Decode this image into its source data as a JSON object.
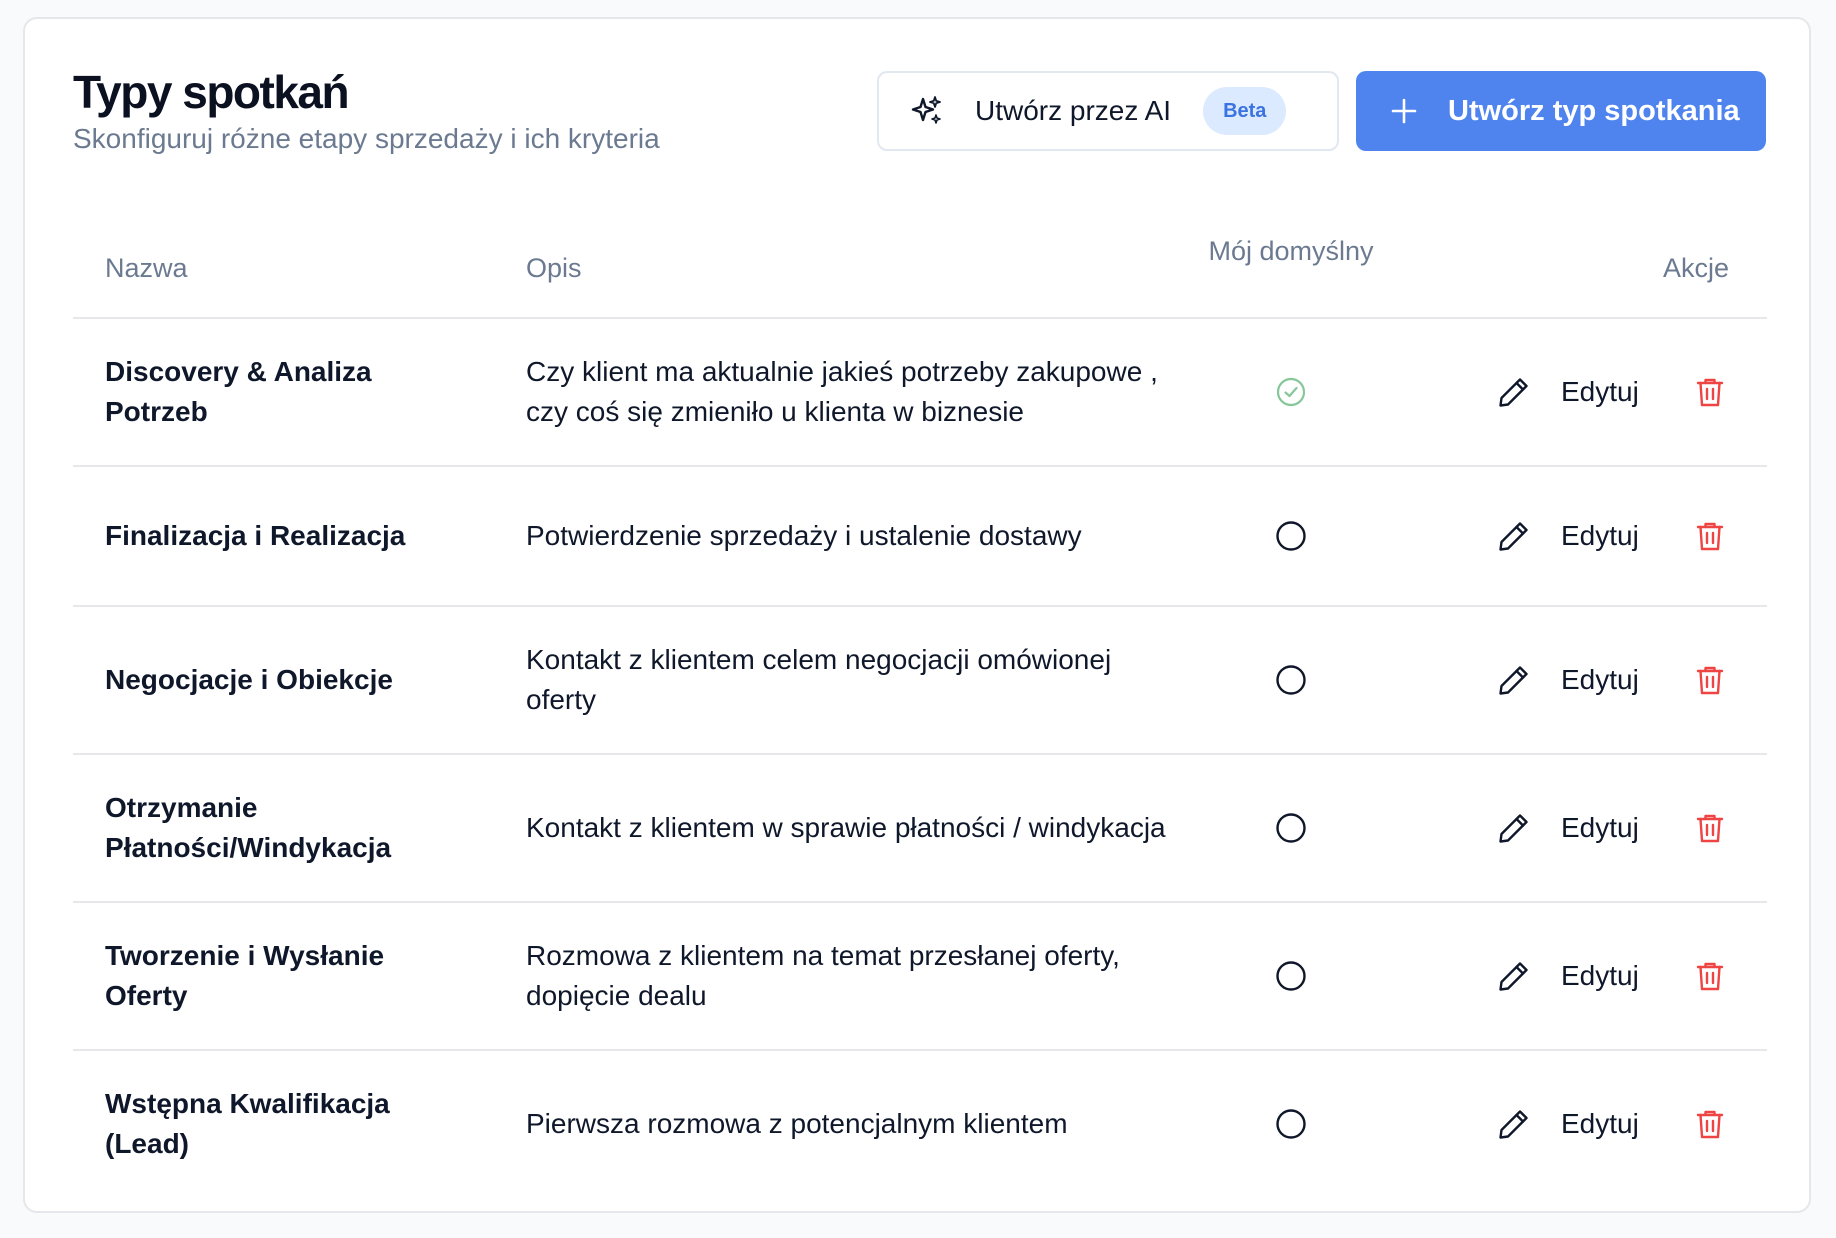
{
  "header": {
    "title": "Typy spotkań",
    "subtitle": "Skonfiguruj różne etapy sprzedaży i ich kryteria"
  },
  "actions": {
    "ai_button_label": "Utwórz przez AI",
    "ai_badge": "Beta",
    "create_button_label": "Utwórz typ spotkania"
  },
  "colors": {
    "primary": "#4f84ef",
    "danger": "#ef4444",
    "success": "#86c79a",
    "muted": "#6b7a90"
  },
  "table": {
    "columns": {
      "name": "Nazwa",
      "description": "Opis",
      "default": "Mój domyślny",
      "actions": "Akcje"
    },
    "edit_label": "Edytuj",
    "rows": [
      {
        "name": "Discovery & Analiza Potrzeb",
        "description": "Czy klient ma aktualnie jakieś potrzeby zakupowe , czy coś się zmieniło u klienta w biznesie",
        "is_default": true
      },
      {
        "name": "Finalizacja i Realizacja",
        "description": "Potwierdzenie sprzedaży i ustalenie dostawy",
        "is_default": false
      },
      {
        "name": "Negocjacje i Obiekcje",
        "description": "Kontakt z klientem celem negocjacji omówionej oferty",
        "is_default": false
      },
      {
        "name": "Otrzymanie Płatności/Windykacja",
        "description": "Kontakt z klientem w sprawie płatności / windykacja",
        "is_default": false
      },
      {
        "name": "Tworzenie i Wysłanie Oferty",
        "description": "Rozmowa z klientem na temat przesłanej oferty, dopięcie dealu",
        "is_default": false
      },
      {
        "name": "Wstępna Kwalifikacja (Lead)",
        "description": "Pierwsza rozmowa z potencjalnym klientem",
        "is_default": false
      }
    ]
  }
}
